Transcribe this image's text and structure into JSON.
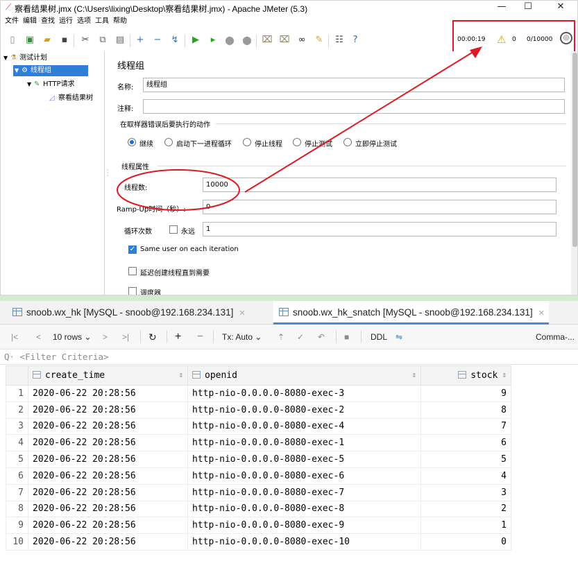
{
  "jmeter": {
    "window_title": "察看结果树.jmx (C:\\Users\\lixing\\Desktop\\察看结果树.jmx) - Apache JMeter (5.3)",
    "window_buttons": [
      "—",
      "☐",
      "✕"
    ],
    "menu": [
      "文件",
      "编辑",
      "查找",
      "运行",
      "选项",
      "工具",
      "帮助"
    ],
    "status": {
      "elapsed": "00:00:19",
      "warnings": "0",
      "threads": "0/10000"
    },
    "tree": [
      {
        "label": "测试计划",
        "icon": "flask-icon"
      },
      {
        "label": "线程组",
        "icon": "gear-icon"
      },
      {
        "label": "HTTP请求",
        "icon": "pipette-icon"
      },
      {
        "label": "察看结果树",
        "icon": "chart-icon"
      }
    ],
    "panel": {
      "title": "线程组",
      "name_label": "名称:",
      "name_value": "线程组",
      "comment_label": "注释:",
      "comment_value": "",
      "error_group_label": "在取样器错误后要执行的动作",
      "error_actions": [
        "继续",
        "启动下一进程循环",
        "停止线程",
        "停止测试",
        "立即停止测试"
      ],
      "error_selected": 0,
      "props_group_label": "线程属性",
      "threads_label": "线程数:",
      "threads_value": "10000",
      "rampup_label": "Ramp-Up时间（秒）:",
      "rampup_value": "0",
      "loop_label": "循环次数",
      "forever_label": "永远",
      "loop_value": "1",
      "same_user_label": "Same user on each iteration",
      "delay_label": "延迟创建线程直到需要",
      "scheduler_label": "调度器"
    }
  },
  "db": {
    "tabs": [
      {
        "label": "snoob.wx_hk [MySQL - snoob@192.168.234.131]",
        "active": false
      },
      {
        "label": "snoob.wx_hk_snatch [MySQL - snoob@192.168.234.131]",
        "active": true
      }
    ],
    "toolbar": {
      "rows": "10 rows",
      "tx": "Tx: Auto",
      "ddl": "DDL",
      "comma": "Comma-..."
    },
    "filter_placeholder": "<Filter Criteria>",
    "columns": [
      "create_time",
      "openid",
      "stock"
    ],
    "rows": [
      [
        "1",
        "2020-06-22 20:28:56",
        "http-nio-0.0.0.0-8080-exec-3",
        "9"
      ],
      [
        "2",
        "2020-06-22 20:28:56",
        "http-nio-0.0.0.0-8080-exec-2",
        "8"
      ],
      [
        "3",
        "2020-06-22 20:28:56",
        "http-nio-0.0.0.0-8080-exec-4",
        "7"
      ],
      [
        "4",
        "2020-06-22 20:28:56",
        "http-nio-0.0.0.0-8080-exec-1",
        "6"
      ],
      [
        "5",
        "2020-06-22 20:28:56",
        "http-nio-0.0.0.0-8080-exec-5",
        "5"
      ],
      [
        "6",
        "2020-06-22 20:28:56",
        "http-nio-0.0.0.0-8080-exec-6",
        "4"
      ],
      [
        "7",
        "2020-06-22 20:28:56",
        "http-nio-0.0.0.0-8080-exec-7",
        "3"
      ],
      [
        "8",
        "2020-06-22 20:28:56",
        "http-nio-0.0.0.0-8080-exec-8",
        "2"
      ],
      [
        "9",
        "2020-06-22 20:28:56",
        "http-nio-0.0.0.0-8080-exec-9",
        "1"
      ],
      [
        "10",
        "2020-06-22 20:28:56",
        "http-nio-0.0.0.0-8080-exec-10",
        "0"
      ]
    ]
  },
  "colors": {
    "annotation_red": "#e0181f",
    "selection_blue": "#2f7fd6",
    "tab_underline": "#4a88da"
  }
}
